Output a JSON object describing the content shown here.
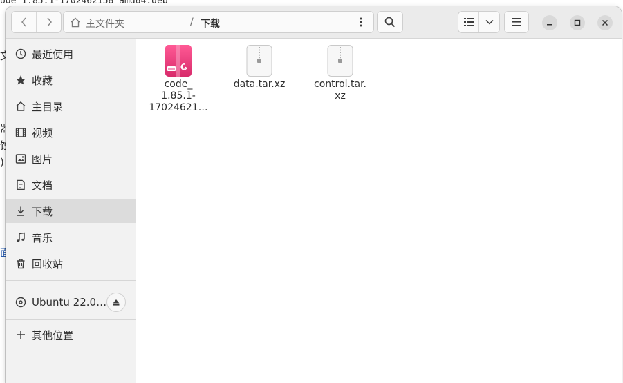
{
  "background": {
    "terminal_line": "ode 1.85.1-1702462158 amd64.deb",
    "fragments": [
      "文",
      "器",
      "蚀",
      ")",
      "面"
    ]
  },
  "toolbar": {
    "back_icon": "chevron-left-icon",
    "forward_icon": "chevron-right-icon",
    "path_home": "主文件夹",
    "path_separator": "/",
    "path_current": "下载",
    "path_menu_icon": "vertical-dots-icon",
    "search_icon": "search-icon",
    "view_icon": "list-view-icon",
    "view_dropdown_icon": "chevron-down-icon",
    "menu_icon": "hamburger-icon"
  },
  "window_controls": [
    "minimize-icon",
    "maximize-icon",
    "close-icon"
  ],
  "sidebar": {
    "items": [
      {
        "label": "最近使用",
        "icon": "clock-icon"
      },
      {
        "label": "收藏",
        "icon": "star-icon"
      },
      {
        "label": "主目录",
        "icon": "home-icon"
      },
      {
        "label": "视频",
        "icon": "film-icon"
      },
      {
        "label": "图片",
        "icon": "image-icon"
      },
      {
        "label": "文档",
        "icon": "document-icon"
      },
      {
        "label": "下载",
        "icon": "download-icon",
        "active": true
      },
      {
        "label": "音乐",
        "icon": "music-icon"
      },
      {
        "label": "回收站",
        "icon": "trash-icon"
      }
    ],
    "devices": [
      {
        "label": "Ubuntu 22.0…",
        "icon": "disc-icon",
        "action_icon": "eject-icon"
      }
    ],
    "other": {
      "label": "其他位置",
      "icon": "plus-icon"
    }
  },
  "files": [
    {
      "name": "code_ 1.85.1-17024621…",
      "line1": "code_",
      "line2": "1.85.1-",
      "line3": "17024621…",
      "icon": "debian-package-icon",
      "color": "#e93a7d"
    },
    {
      "name": "data.tar.xz",
      "line1": "data.tar.xz",
      "line2": "",
      "line3": "",
      "icon": "archive-icon",
      "color": "#f5f5f5"
    },
    {
      "name": "control.tar.xz",
      "line1": "control.tar.",
      "line2": "xz",
      "line3": "",
      "icon": "archive-icon",
      "color": "#f5f5f5"
    }
  ],
  "colors": {
    "accent": "#e93a7d",
    "sidebar_active": "#dcdcdc",
    "headerbar": "#ebebeb"
  }
}
